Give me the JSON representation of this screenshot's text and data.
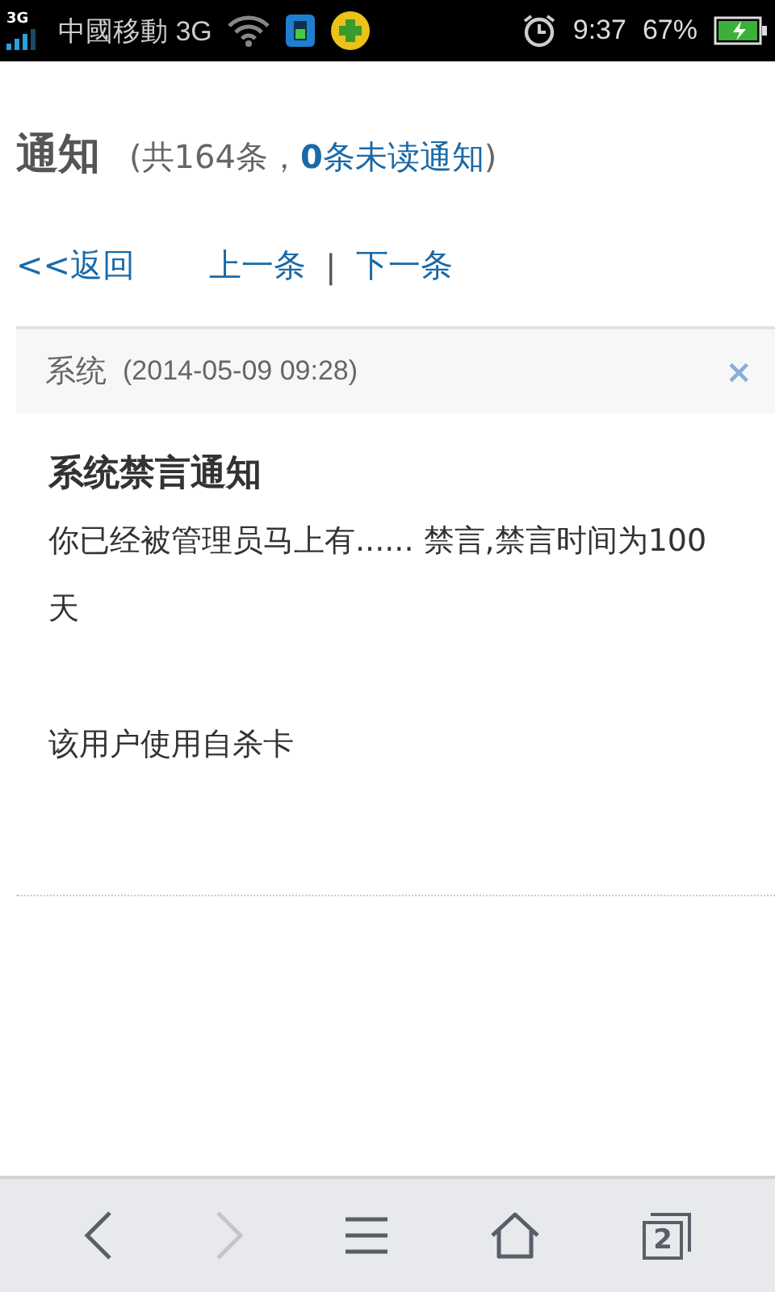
{
  "status_bar": {
    "network_type": "3G",
    "carrier": "中國移動 3G",
    "time": "9:37",
    "battery": "67%"
  },
  "header": {
    "title": "通知",
    "prefix": "(共164条，",
    "unread_link": "**0**条未读通知",
    "suffix": ")"
  },
  "nav": {
    "back": "<<返回",
    "prev": "上一条",
    "separator": "|",
    "next": "下一条"
  },
  "notice": {
    "sender": "系统",
    "date": "(2014-05-09 09:28)",
    "close": "×",
    "title": "系统禁言通知",
    "paragraphs": [
      "你已经被管理员马上有...... 禁言,禁言时间为100 天",
      "该用户使用自杀卡"
    ]
  },
  "toolbar": {
    "items": [
      {
        "kind": "back",
        "disabled": false
      },
      {
        "kind": "forward",
        "disabled": true
      },
      {
        "kind": "menu",
        "disabled": false
      },
      {
        "kind": "home",
        "disabled": false
      },
      {
        "kind": "tabs",
        "disabled": false,
        "count": "2"
      }
    ]
  }
}
